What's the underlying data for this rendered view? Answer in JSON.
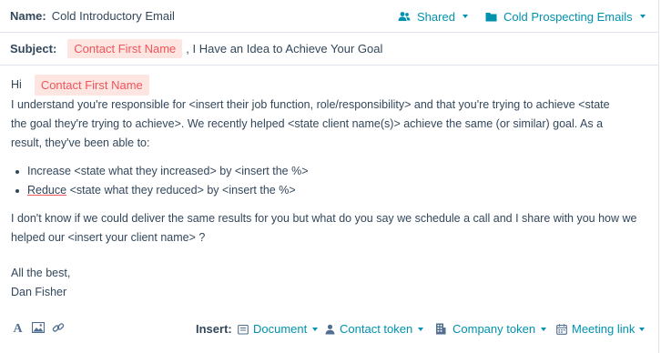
{
  "header": {
    "name_label": "Name:",
    "name_value": "Cold Introductory Email",
    "shared_label": "Shared",
    "folder_label": "Cold Prospecting Emails"
  },
  "subject": {
    "label": "Subject:",
    "token": "Contact First Name",
    "rest": ", I Have an Idea to Achieve Your Goal"
  },
  "body": {
    "greeting": "Hi",
    "greeting_token": "Contact First Name",
    "para1_line1": "I understand you're responsible for <insert their job function, role/responsibility>  and that you're trying to achieve <state",
    "para1_line2": "the goal they're trying to achieve>.  We recently helped <state client name(s)> achieve the same (or similar) goal.  As a",
    "para1_line3": "result, they've been able to:",
    "bullet1": "Increase <state what they increased> by <insert the %>",
    "bullet2_word": "Reduce",
    "bullet2_rest": " <state what they reduced> by <insert the %>",
    "para2_line1": "I don't know if we could deliver the same results for you but what do you say we schedule a call and I share with you how we",
    "para2_line2": "helped our <insert your client name> ?",
    "signoff": "All the best,",
    "signature": "Dan Fisher"
  },
  "toolbar": {
    "insert_label": "Insert:",
    "document": "Document",
    "contact_token": "Contact token",
    "company_token": "Company token",
    "meeting_link": "Meeting link"
  },
  "colors": {
    "link": "#0091ae",
    "token_bg": "#fde6e1",
    "token_text": "#f2545b",
    "text": "#33475b",
    "border": "#dfe3eb"
  }
}
